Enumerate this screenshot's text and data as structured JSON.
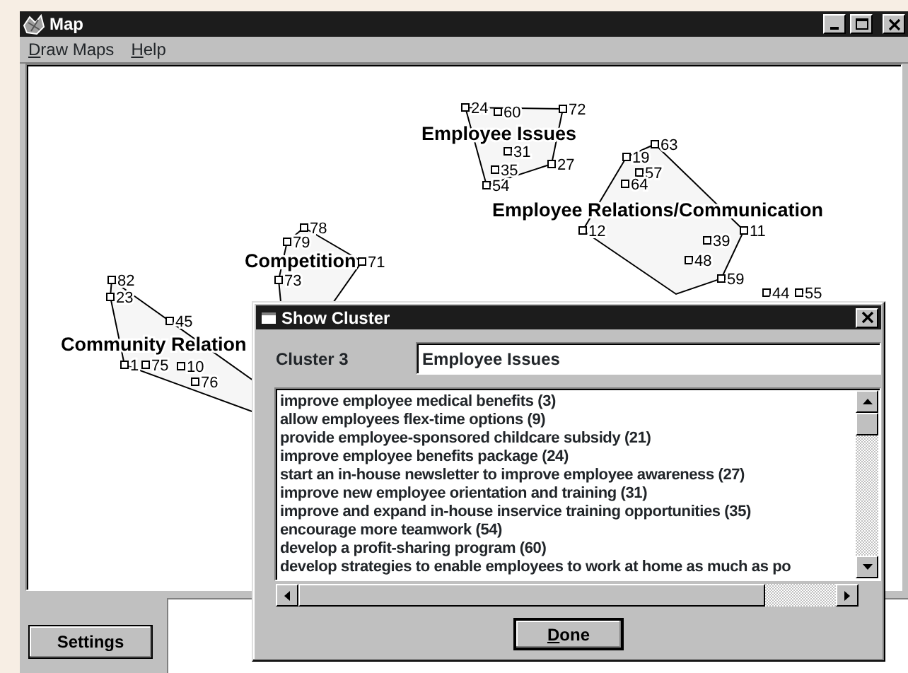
{
  "window": {
    "title": "Map"
  },
  "menu": [
    {
      "label": "Draw Maps"
    },
    {
      "label": "Help"
    }
  ],
  "map": {
    "clusters": [
      {
        "name": "Employee Issues",
        "points": [
          "24",
          "60",
          "72",
          "31",
          "27",
          "35",
          "54"
        ]
      },
      {
        "name": "Competition",
        "points": [
          "78",
          "79",
          "73",
          "71"
        ]
      },
      {
        "name": "Employee Relations/Communication",
        "points": [
          "63",
          "19",
          "57",
          "64",
          "12",
          "39",
          "11",
          "48",
          "59"
        ]
      },
      {
        "name": "Community Relation",
        "points": [
          "82",
          "23",
          "45",
          "1",
          "75",
          "10",
          "76"
        ]
      }
    ],
    "loose_points": [
      "44",
      "55"
    ]
  },
  "settings_button": "Settings",
  "dialog": {
    "title": "Show Cluster",
    "cluster_label": "Cluster 3",
    "cluster_name": "Employee Issues",
    "items": [
      "improve employee medical benefits (3)",
      "allow employees flex-time options (9)",
      "provide employee-sponsored childcare subsidy (21)",
      "improve employee benefits package (24)",
      "start an in-house newsletter to improve employee awareness (27)",
      "improve new employee orientation and training (31)",
      "improve and expand in-house inservice training opportunities (35)",
      "encourage more teamwork (54)",
      "develop a profit-sharing program (60)",
      "develop strategies to enable employees to work at home as much as po"
    ],
    "done_button": "Done"
  }
}
